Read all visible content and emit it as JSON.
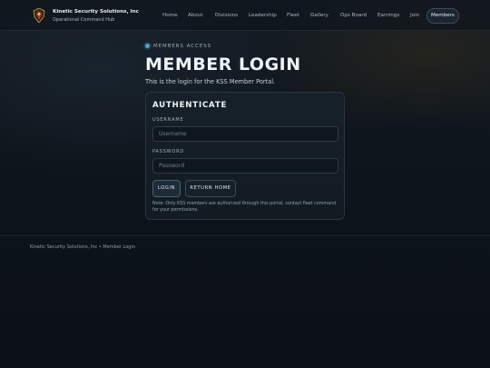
{
  "header": {
    "brand_name": "Kinetic Security Solutions, Inc",
    "brand_sub": "Operational Command Hub",
    "nav": [
      "Home",
      "About",
      "Divisions",
      "Leadership",
      "Fleet",
      "Gallery",
      "Ops Board",
      "Earnings",
      "Join"
    ],
    "members_label": "Members"
  },
  "hero": {
    "eyebrow": "MEMBERS ACCESS",
    "title": "MEMBER LOGIN",
    "subtitle": "This is the login for the KSS Member Portal."
  },
  "card": {
    "title": "AUTHENTICATE",
    "username_label": "USERNAME",
    "username_placeholder": "Username",
    "username_value": "",
    "password_label": "PASSWORD",
    "password_placeholder": "Password",
    "password_value": "",
    "login_label": "LOGIN",
    "return_label": "RETURN HOME",
    "note": "Note: Only KSS members are authorized through this portal, contact fleet command for your permissions."
  },
  "footer": {
    "text": "Kinetic Security Solutions, Inc • Member Login"
  },
  "colors": {
    "background": "#0b1117",
    "accent": "#4aa0c8",
    "logo_red": "#b13a2a",
    "logo_gold": "#c9a24a"
  },
  "icons": {
    "logo": "kss-shield-logo-icon",
    "eyebrow": "status-dot-icon"
  }
}
